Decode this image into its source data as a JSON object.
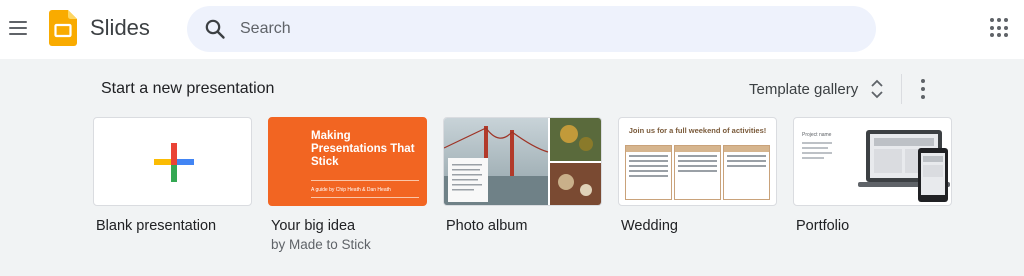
{
  "app": {
    "title": "Slides",
    "brand_color": "#f9ab00"
  },
  "search": {
    "placeholder": "Search"
  },
  "icons": {
    "menu": "hamburger-menu-icon",
    "search": "search-icon",
    "apps": "apps-grid-icon",
    "unfold": "unfold-more-icon",
    "more": "more-vert-icon"
  },
  "templates": {
    "section_title": "Start a new presentation",
    "gallery_label": "Template gallery",
    "items": [
      {
        "title": "Blank presentation",
        "subtitle": ""
      },
      {
        "title": "Your big idea",
        "subtitle": "by Made to Stick",
        "thumb_text": "Making Presentations That Stick",
        "thumb_byline": "A guide by Chip Heath & Dan Heath"
      },
      {
        "title": "Photo album",
        "subtitle": ""
      },
      {
        "title": "Wedding",
        "subtitle": "",
        "thumb_text": "Join us for a full weekend of activities!",
        "thumb_days": [
          "Thursday",
          "Friday",
          "Saturday"
        ],
        "thumb_events": [
          "Spa at 2pm",
          "Golf at 7am",
          "Brunch at noon"
        ]
      },
      {
        "title": "Portfolio",
        "subtitle": "",
        "thumb_text": "Project name"
      }
    ]
  },
  "colors": {
    "band": "#f1f3f4",
    "search_bg": "#eef2fc",
    "big_idea_orange": "#f26522"
  }
}
